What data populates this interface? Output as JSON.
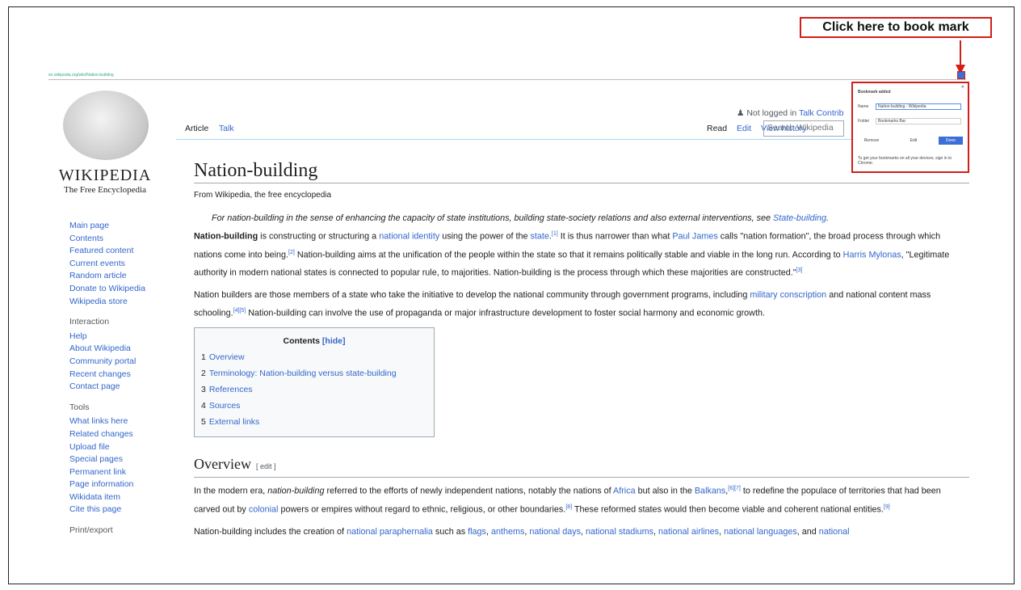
{
  "callout": {
    "text": "Click here to book mark"
  },
  "browser": {
    "url": "en.wikipedia.org/wiki/Nation-building"
  },
  "logo": {
    "wordmark": "WIKIPEDIA",
    "tagline": "The Free Encyclopedia"
  },
  "sidebar": {
    "main": [
      "Main page",
      "Contents",
      "Featured content",
      "Current events",
      "Random article",
      "Donate to Wikipedia",
      "Wikipedia store"
    ],
    "interaction_heading": "Interaction",
    "interaction": [
      "Help",
      "About Wikipedia",
      "Community portal",
      "Recent changes",
      "Contact page"
    ],
    "tools_heading": "Tools",
    "tools": [
      "What links here",
      "Related changes",
      "Upload file",
      "Special pages",
      "Permanent link",
      "Page information",
      "Wikidata item",
      "Cite this page"
    ],
    "print_heading": "Print/export"
  },
  "user": {
    "not_logged": "Not logged in",
    "talk": "Talk",
    "contrib": "Contrib"
  },
  "tabs": {
    "article": "Article",
    "talk": "Talk",
    "read": "Read",
    "edit": "Edit",
    "history": "View history"
  },
  "search": {
    "placeholder": "Search Wikipedia"
  },
  "popup": {
    "title": "Bookmark added",
    "name_label": "Name",
    "name_value": "Nation-building - Wikipedia",
    "folder_label": "Folder",
    "folder_value": "Bookmarks Bar",
    "remove": "Remove",
    "edit": "Edit",
    "done": "Done",
    "note": "To get your bookmarks on all your devices, sign in to Chrome."
  },
  "article": {
    "title": "Nation-building",
    "subtitle": "From Wikipedia, the free encyclopedia",
    "hatnote_pre": "For nation-building in the sense of enhancing the capacity of state institutions, building state-society relations and also external interventions, see ",
    "hatnote_link": "State-building",
    "hatnote_post": ".",
    "p1": {
      "bold": "Nation-building",
      "t1": " is constructing or structuring a ",
      "l1": "national identity",
      "t2": " using the power of the ",
      "l2": "state",
      "s1": "[1]",
      "t3": " It is thus narrower than what ",
      "l3": "Paul James",
      "t4": " calls \"nation formation\", the broad process through which nations come into being.",
      "s2": "[2]",
      "t5": " Nation-building aims at the unification of the people within the state so that it remains politically stable and viable in the long run. According to ",
      "l4": "Harris Mylonas",
      "t6": ", \"Legitimate authority in modern national states is connected to popular rule, to majorities. Nation-building is the process through which these majorities are constructed.\"",
      "s3": "[3]"
    },
    "p2": {
      "t1": "Nation builders are those members of a state who take the initiative to develop the national community through government programs, including ",
      "l1": "military conscription",
      "t2": " and national content mass schooling.",
      "s1": "[4][5]",
      "t3": " Nation-building can involve the use of propaganda or major infrastructure development to foster social harmony and economic growth."
    },
    "toc": {
      "title": "Contents",
      "hide": "[hide]",
      "items": [
        {
          "n": "1",
          "label": "Overview"
        },
        {
          "n": "2",
          "label": "Terminology: Nation-building versus state-building"
        },
        {
          "n": "3",
          "label": "References"
        },
        {
          "n": "4",
          "label": "Sources"
        },
        {
          "n": "5",
          "label": "External links"
        }
      ]
    },
    "overview": {
      "heading": "Overview",
      "edit": "[ edit ]",
      "p1": {
        "t1": "In the modern era, ",
        "i1": "nation-building",
        "t2": " referred to the efforts of newly independent nations, notably the nations of ",
        "l1": "Africa",
        "t3": " but also in the ",
        "l2": "Balkans",
        "s1": "[6][7]",
        "t4": " to redefine the populace of territories that had been carved out by ",
        "l3": "colonial",
        "t5": " powers or empires without regard to ethnic, religious, or other boundaries.",
        "s2": "[8]",
        "t6": " These reformed states would then become viable and coherent national entities.",
        "s3": "[9]"
      },
      "p2": {
        "t1": "Nation-building includes the creation of ",
        "l1": "national paraphernalia",
        "t2": " such as ",
        "l2": "flags",
        "l3": "anthems",
        "l4": "national days",
        "l5": "national stadiums",
        "l6": "national airlines",
        "l7": "national languages",
        "t3": ", and ",
        "l8": "national"
      }
    }
  }
}
